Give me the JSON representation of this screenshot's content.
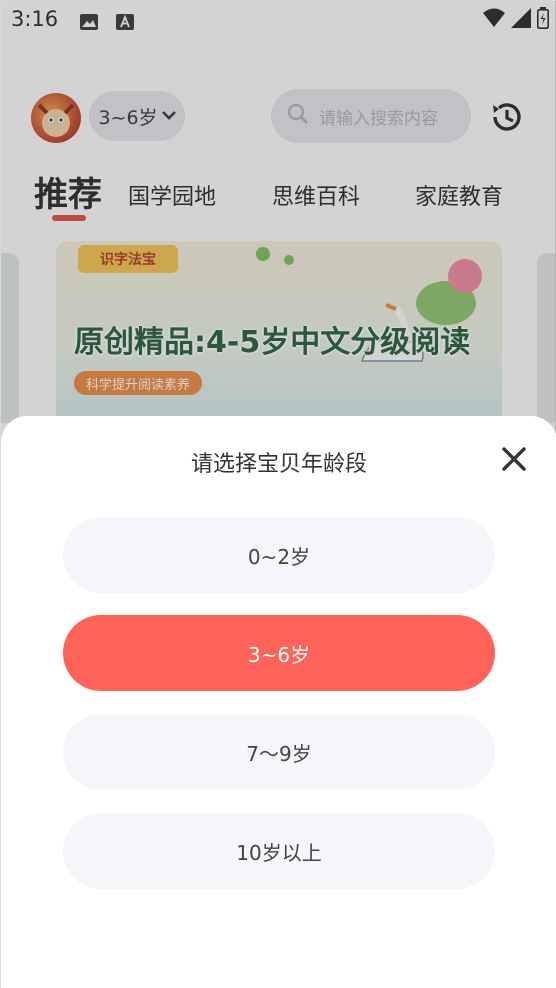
{
  "status_bar": {
    "time": "3:16"
  },
  "header": {
    "age_selector_label": "3~6岁",
    "search_placeholder": "请输入搜索内容"
  },
  "tabs": [
    {
      "label": "推荐",
      "active": true
    },
    {
      "label": "国学园地"
    },
    {
      "label": "思维百科"
    },
    {
      "label": "家庭教育"
    }
  ],
  "banner": {
    "tag": "识字法宝",
    "title": "原创精品:4-5岁中文分级阅读",
    "subtitle": "科学提升阅读素养"
  },
  "sheet": {
    "title": "请选择宝贝年龄段",
    "options": [
      {
        "label": "0~2岁",
        "selected": false
      },
      {
        "label": "3~6岁",
        "selected": true
      },
      {
        "label": "7〜9岁",
        "selected": false
      },
      {
        "label": "10岁以上",
        "selected": false
      }
    ]
  },
  "colors": {
    "accent": "#fe6359",
    "option_bg": "#f5f5fa",
    "tab_underline": "#e34a3f"
  }
}
